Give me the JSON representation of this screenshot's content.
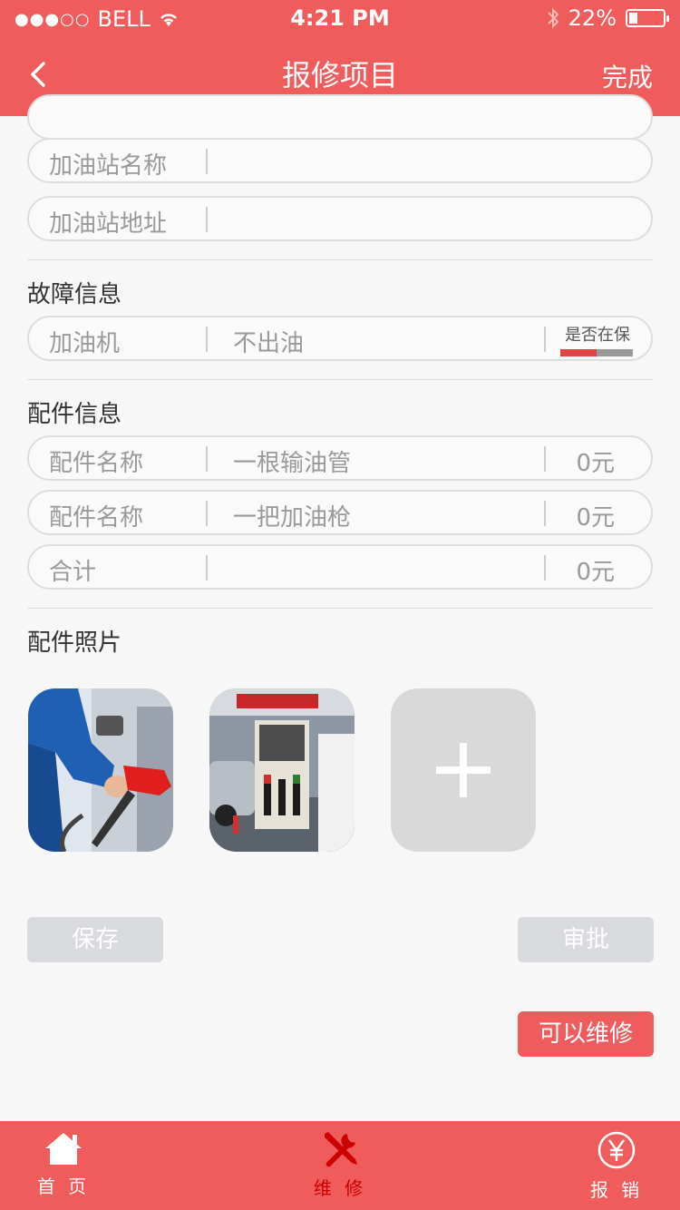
{
  "status_bar": {
    "signal": "●●●○○",
    "carrier": "BELL",
    "time": "4:21 PM",
    "battery": "22%"
  },
  "nav": {
    "title": "报修项目",
    "done_label": "完成"
  },
  "station": {
    "name_label": "加油站名称",
    "name_value": "",
    "address_label": "加油站地址",
    "address_value": ""
  },
  "fault": {
    "section_title": "故障信息",
    "device_label": "加油机",
    "description": "不出油",
    "warranty_label": "是否在保"
  },
  "parts": {
    "section_title": "配件信息",
    "items": [
      {
        "label": "配件名称",
        "name": "一根输油管",
        "price": "0元"
      },
      {
        "label": "配件名称",
        "name": "一把加油枪",
        "price": "0元"
      }
    ],
    "total_label": "合计",
    "total_price": "0元"
  },
  "photos": {
    "section_title": "配件照片"
  },
  "actions": {
    "save_label": "保存",
    "approve_label": "审批",
    "repairable_label": "可以维修"
  },
  "tabs": [
    {
      "label": "首 页",
      "icon": "home-icon"
    },
    {
      "label": "维 修",
      "icon": "wrench-screwdriver-icon"
    },
    {
      "label": "报 销",
      "icon": "yen-icon"
    }
  ],
  "colors": {
    "brand": "#f05b5b",
    "active_tab": "#cc0000",
    "button_gray": "#d9dadd"
  }
}
